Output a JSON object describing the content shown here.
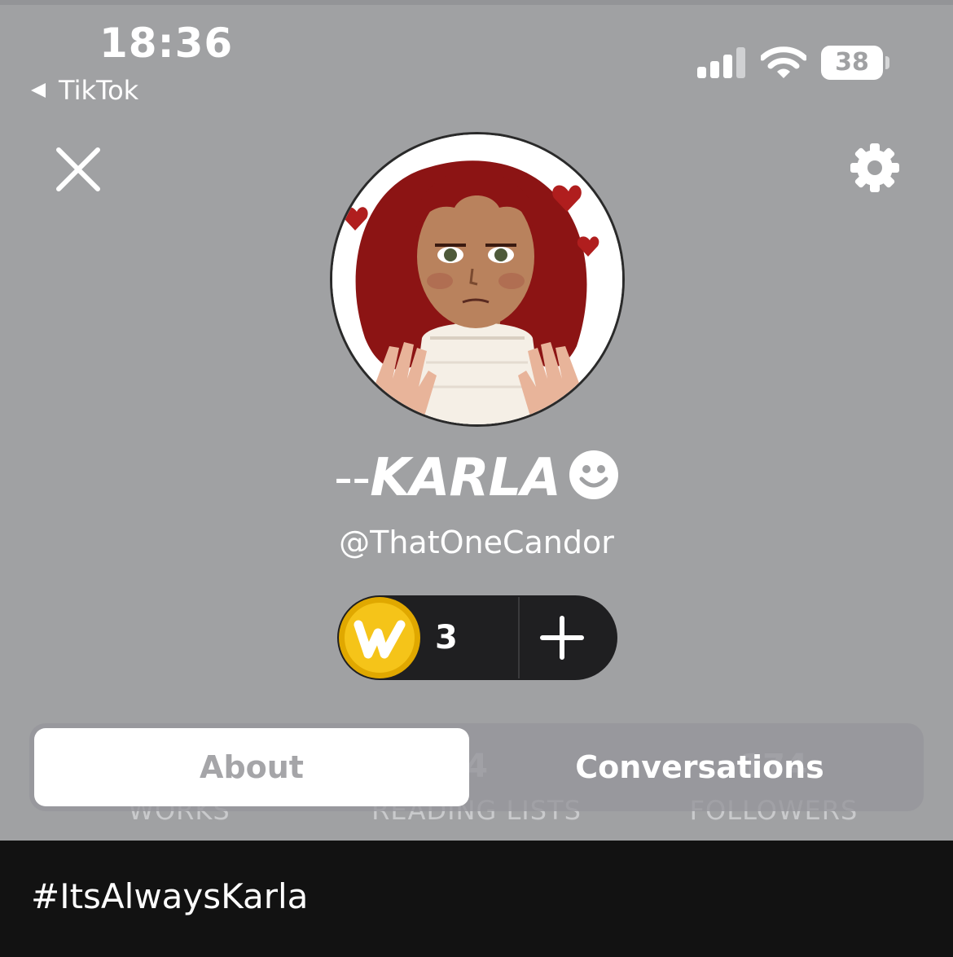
{
  "status_bar": {
    "time": "18:36",
    "back_app": "TikTok",
    "battery": "38"
  },
  "header": {
    "close_icon": "close-icon",
    "settings_icon": "gear-icon"
  },
  "profile": {
    "avatar_description_icon": "avatar",
    "name_prefix": "--",
    "name": "KARLA",
    "name_emoji": "smiley-icon",
    "handle": "@ThatOneCandor"
  },
  "coins": {
    "icon": "wattpad-coin-icon",
    "count": "3",
    "add_icon": "plus-icon"
  },
  "stats": {
    "works_label": "WORKS",
    "reading_lists_count": "4",
    "reading_lists_label": "READING LISTS",
    "followers_count": "174",
    "followers_label": "FOLLOWERS"
  },
  "tabs": [
    {
      "label": "About",
      "selected": true
    },
    {
      "label": "Conversations",
      "selected": false
    }
  ],
  "footer": {
    "hashtag": "#ItsAlwaysKarla"
  },
  "colors": {
    "background": "#a0a1a3",
    "pill": "#1f1f21",
    "coin": "#f5c419",
    "bottom": "#121212"
  }
}
